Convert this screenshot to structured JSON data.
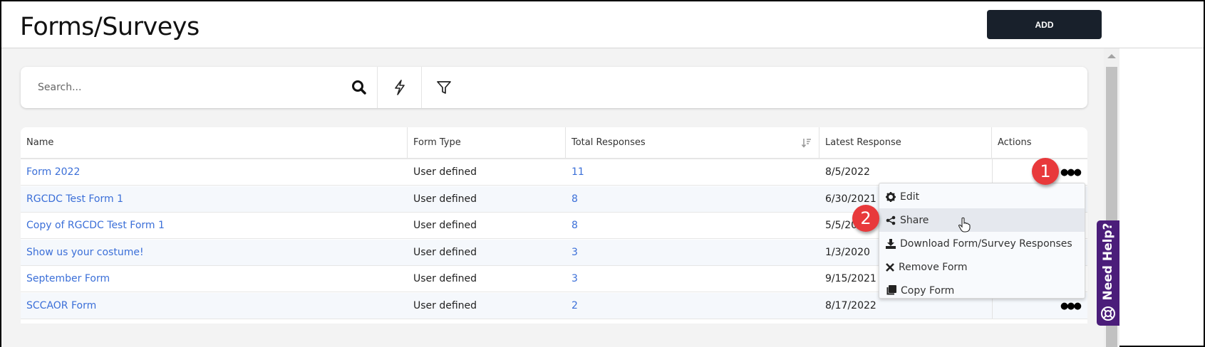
{
  "header": {
    "title": "Forms/Surveys",
    "add_label": "ADD"
  },
  "search": {
    "placeholder": "Search...",
    "icons": [
      "search-icon",
      "lightning-icon",
      "filter-icon"
    ]
  },
  "table": {
    "columns": [
      "Name",
      "Form Type",
      "Total Responses",
      "Latest Response",
      "Actions"
    ],
    "sort_column": "Total Responses",
    "rows": [
      {
        "name": "Form 2022",
        "type": "User defined",
        "responses": "11",
        "latest": "8/5/2022"
      },
      {
        "name": "RGCDC Test Form 1",
        "type": "User defined",
        "responses": "8",
        "latest": "6/30/2021"
      },
      {
        "name": "Copy of RGCDC Test Form 1",
        "type": "User defined",
        "responses": "8",
        "latest": "5/5/2022"
      },
      {
        "name": "Show us your costume!",
        "type": "User defined",
        "responses": "3",
        "latest": "1/3/2020"
      },
      {
        "name": "September Form",
        "type": "User defined",
        "responses": "3",
        "latest": "9/15/2021"
      },
      {
        "name": "SCCAOR Form",
        "type": "User defined",
        "responses": "2",
        "latest": "8/17/2022"
      }
    ]
  },
  "menu": {
    "items": [
      {
        "label": "Edit",
        "icon": "gear-icon"
      },
      {
        "label": "Share",
        "icon": "share-icon",
        "hovered": true
      },
      {
        "label": "Download Form/Survey Responses",
        "icon": "download-icon"
      },
      {
        "label": "Remove Form",
        "icon": "close-icon"
      },
      {
        "label": "Copy Form",
        "icon": "copy-icon"
      }
    ]
  },
  "badges": [
    "1",
    "2"
  ],
  "help": {
    "label": "Need Help?"
  },
  "colors": {
    "accent": "#3b6fd8",
    "add_button": "#18202b",
    "badge": "#e8393b",
    "help": "#4b1d7a"
  }
}
